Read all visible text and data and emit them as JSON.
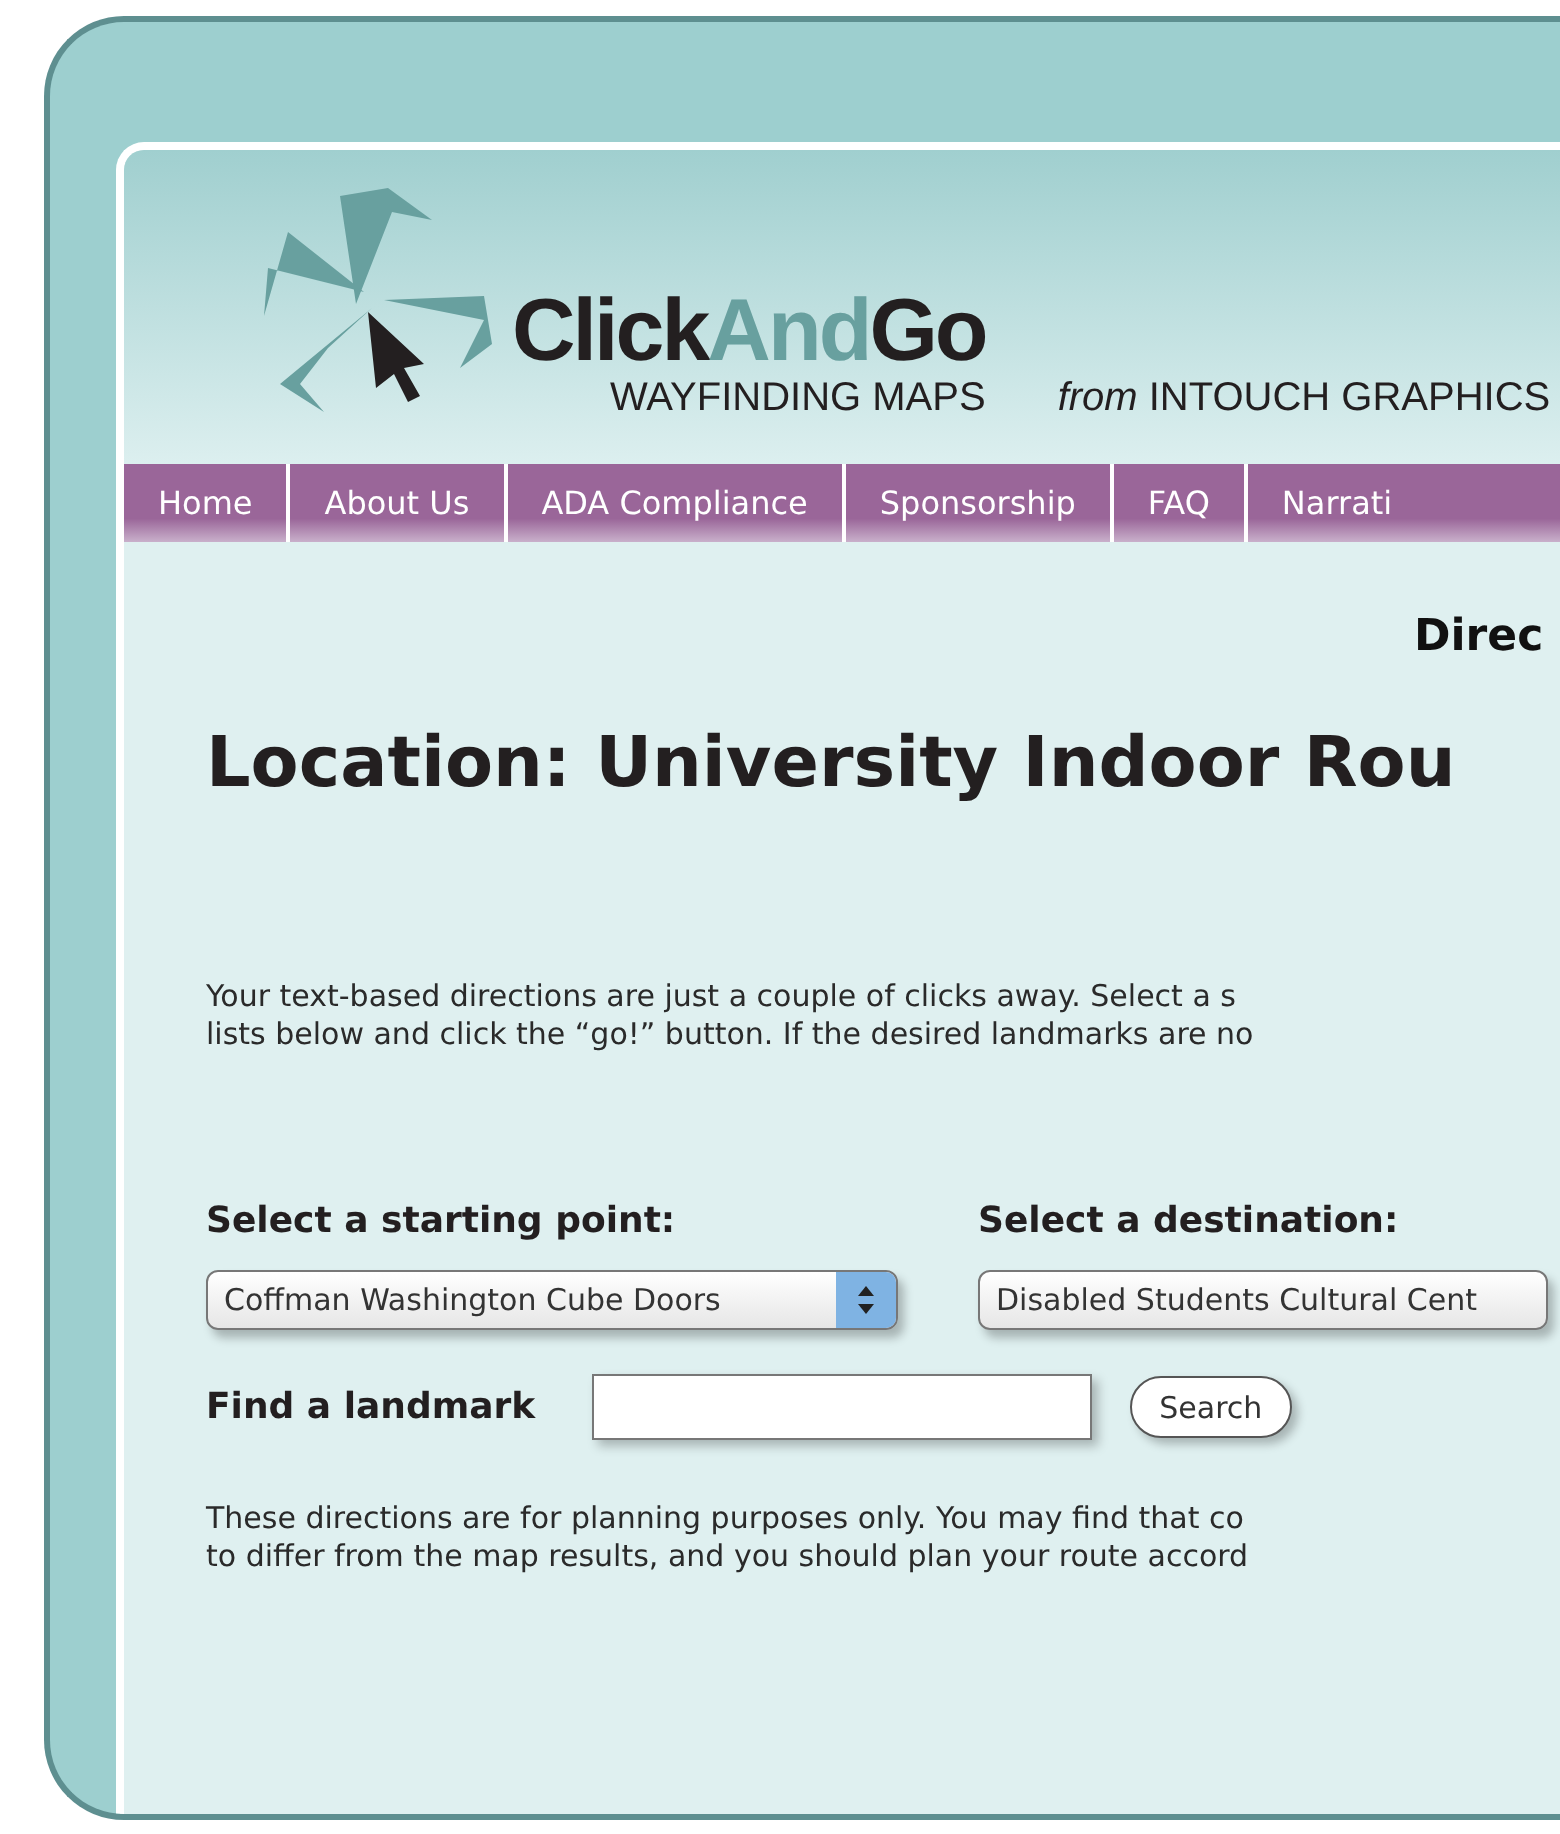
{
  "logo": {
    "name_parts": [
      {
        "text": "Click",
        "accent": false
      },
      {
        "text": "And",
        "accent": true
      },
      {
        "text": "Go",
        "accent": false
      }
    ],
    "tagline": "WAYFINDING MAPS",
    "publisher": "*from* INTOUCH GRAPHICS"
  },
  "nav": [
    {
      "label": "Home"
    },
    {
      "label": "About Us"
    },
    {
      "label": "ADA Compliance"
    },
    {
      "label": "Sponsorship"
    },
    {
      "label": "FAQ"
    },
    {
      "label": "Narrati"
    }
  ],
  "section_title": "Direc",
  "location_title": "Location: University Indoor Rou",
  "intro": [
    "Your text-based directions are just a couple of clicks away. Select a s",
    "lists below and click the “go!” button. If the desired landmarks are no"
  ],
  "start": {
    "label": "Select a starting point:",
    "value": "Coffman Washington Cube Doors"
  },
  "destination": {
    "label": "Select a destination:",
    "value": "Disabled Students Cultural Cent"
  },
  "find": {
    "label": "Find a landmark",
    "button": "Search"
  },
  "disclaimer": [
    "These directions are for planning purposes only. You may find that co",
    "to differ from the map results, and you should plan your route accord"
  ]
}
